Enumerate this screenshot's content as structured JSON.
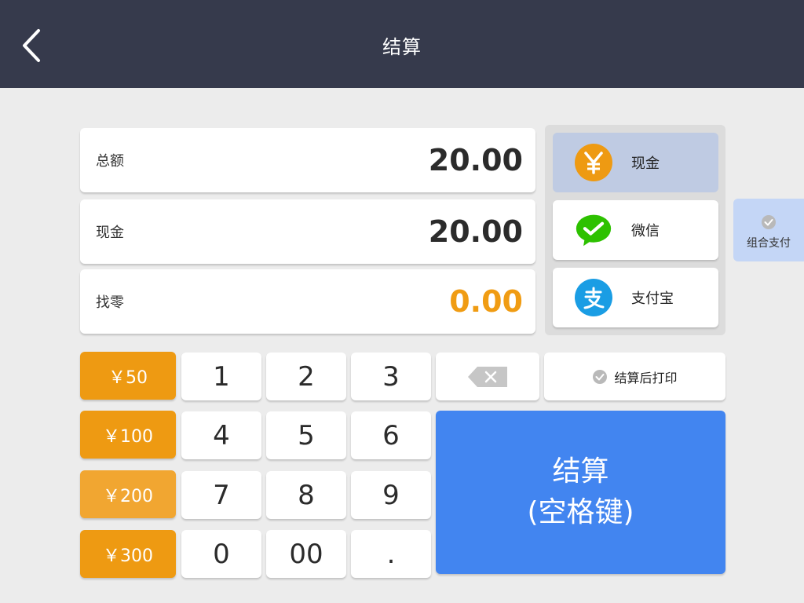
{
  "header": {
    "title": "结算"
  },
  "amounts": {
    "total_label": "总额",
    "total_value": "20.00",
    "cash_label": "现金",
    "cash_value": "20.00",
    "change_label": "找零",
    "change_value": "0.00"
  },
  "payment_methods": [
    {
      "label": "现金",
      "icon": "yen-icon",
      "selected": true
    },
    {
      "label": "微信",
      "icon": "wechat-icon",
      "selected": false
    },
    {
      "label": "支付宝",
      "icon": "alipay-icon",
      "selected": false
    }
  ],
  "combo_payment": {
    "label": "组合支付"
  },
  "quick_amounts": [
    "￥50",
    "￥100",
    "￥200",
    "￥300"
  ],
  "keypad": {
    "k1": "1",
    "k2": "2",
    "k3": "3",
    "k4": "4",
    "k5": "5",
    "k6": "6",
    "k7": "7",
    "k8": "8",
    "k9": "9",
    "k0": "0",
    "k00": "00",
    "kdot": "."
  },
  "print_after": {
    "label": "结算后打印"
  },
  "checkout": {
    "line1": "结算",
    "line2": "(空格键)"
  },
  "colors": {
    "header_bg": "#363a4c",
    "accent_orange": "#ee9a12",
    "checkout_blue": "#4285f0",
    "selected_pay": "#bfcbe3",
    "wechat_green": "#2dc100",
    "alipay_blue": "#1a9de4"
  }
}
